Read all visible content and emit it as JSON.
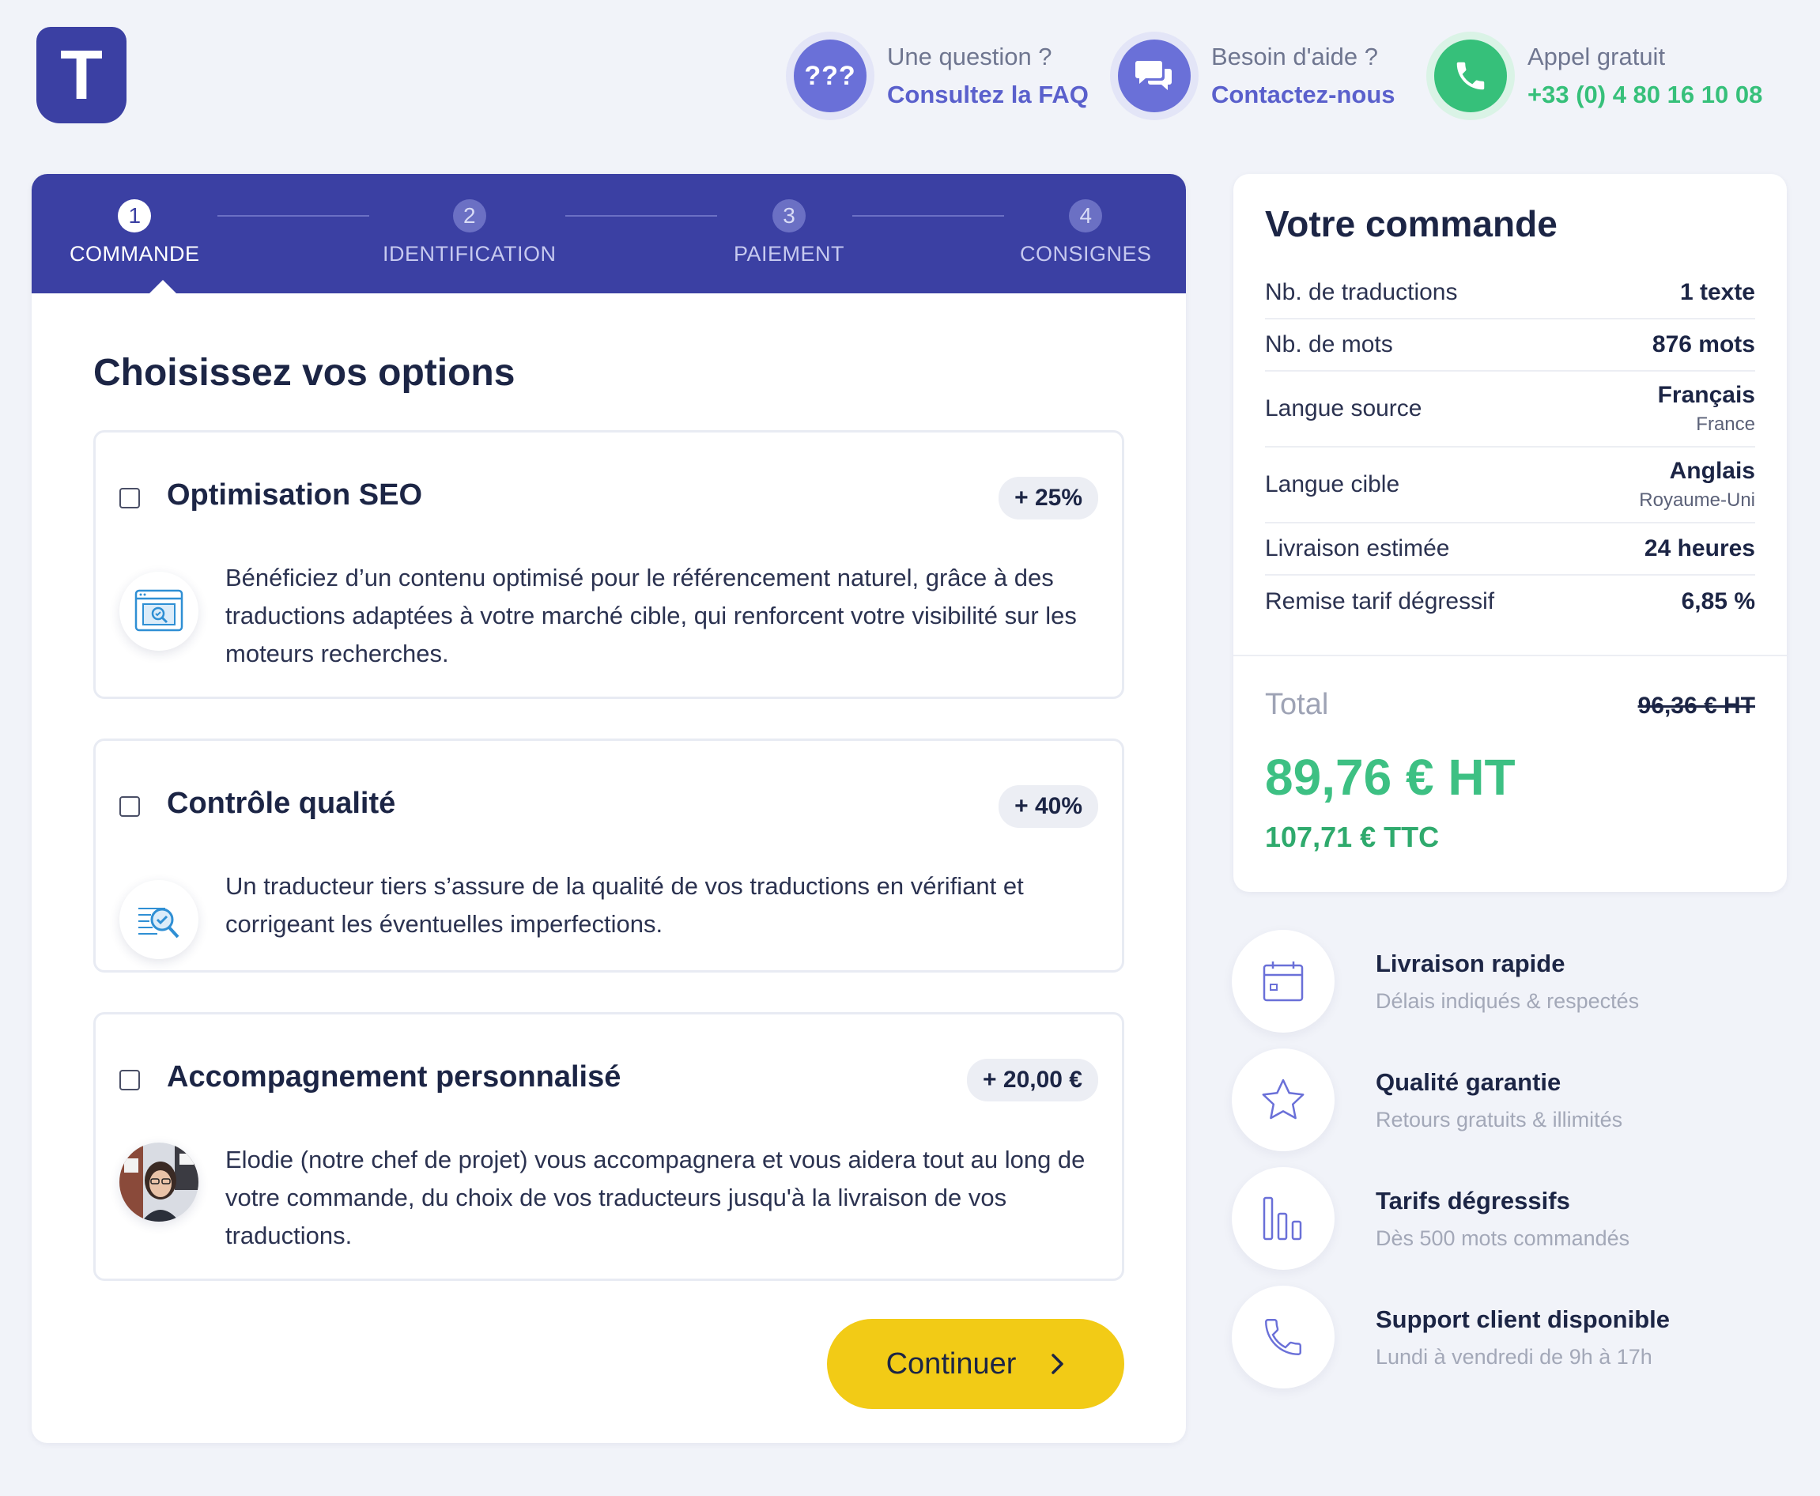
{
  "logo": {
    "letter": "T"
  },
  "header": {
    "faq": {
      "icon": "question-marks-icon",
      "badge": "???",
      "line1": "Une question ?",
      "line2": "Consultez la FAQ"
    },
    "contact": {
      "icon": "chat-icon",
      "line1": "Besoin d'aide ?",
      "line2": "Contactez-nous"
    },
    "phone": {
      "icon": "phone-icon",
      "line1": "Appel gratuit",
      "line2": "+33 (0) 4 80 16 10 08"
    }
  },
  "stepper": {
    "steps": [
      {
        "num": "1",
        "label": "COMMANDE",
        "active": true
      },
      {
        "num": "2",
        "label": "IDENTIFICATION",
        "active": false
      },
      {
        "num": "3",
        "label": "PAIEMENT",
        "active": false
      },
      {
        "num": "4",
        "label": "CONSIGNES",
        "active": false
      }
    ]
  },
  "main": {
    "title": "Choisissez vos options",
    "options": [
      {
        "title": "Optimisation SEO",
        "badge": "+ 25%",
        "icon": "seo-browser-icon",
        "description": "Bénéficiez d’un contenu optimisé pour le référencement naturel, grâce à des traductions adaptées à votre marché cible, qui renforcent votre visibilité sur les moteurs recherches."
      },
      {
        "title": "Contrôle qualité",
        "badge": "+ 40%",
        "icon": "quality-magnifier-icon",
        "description": "Un traducteur tiers s’assure de la qualité de vos traductions en vérifiant et corrigeant les éventuelles imperfections."
      },
      {
        "title": "Accompagnement personnalisé",
        "badge": "+ 20,00 €",
        "icon": "project-manager-avatar",
        "description": "Elodie (notre chef de projet) vous accompagnera et vous aidera tout au long de votre commande, du choix de vos traducteurs jusqu'à la livraison de vos traductions."
      }
    ],
    "continue_label": "Continuer"
  },
  "order": {
    "title": "Votre commande",
    "rows": [
      {
        "label": "Nb. de traductions",
        "value": "1 texte",
        "sub": ""
      },
      {
        "label": "Nb. de mots",
        "value": "876 mots",
        "sub": ""
      },
      {
        "label": "Langue source",
        "value": "Français",
        "sub": "France"
      },
      {
        "label": "Langue cible",
        "value": "Anglais",
        "sub": "Royaume-Uni"
      },
      {
        "label": "Livraison estimée",
        "value": "24 heures",
        "sub": ""
      },
      {
        "label": "Remise tarif dégressif",
        "value": "6,85 %",
        "sub": ""
      }
    ],
    "total_label": "Total",
    "old_price": "96,36 € HT",
    "price_ht": "89,76 € HT",
    "price_ttc": "107,71 € TTC"
  },
  "features": [
    {
      "icon": "calendar-icon",
      "title": "Livraison rapide",
      "subtitle": "Délais indiqués & respectés"
    },
    {
      "icon": "star-icon",
      "title": "Qualité garantie",
      "subtitle": "Retours gratuits & illimités"
    },
    {
      "icon": "bar-chart-icon",
      "title": "Tarifs dégressifs",
      "subtitle": "Dès 500 mots commandés"
    },
    {
      "icon": "phone-outline-icon",
      "title": "Support client disponible",
      "subtitle": "Lundi à vendredi de 9h à 17h"
    }
  ],
  "colors": {
    "brand": "#3b40a3",
    "accent_purple": "#6a70d8",
    "accent_green": "#36c07a",
    "button_yellow": "#f2cb16"
  }
}
